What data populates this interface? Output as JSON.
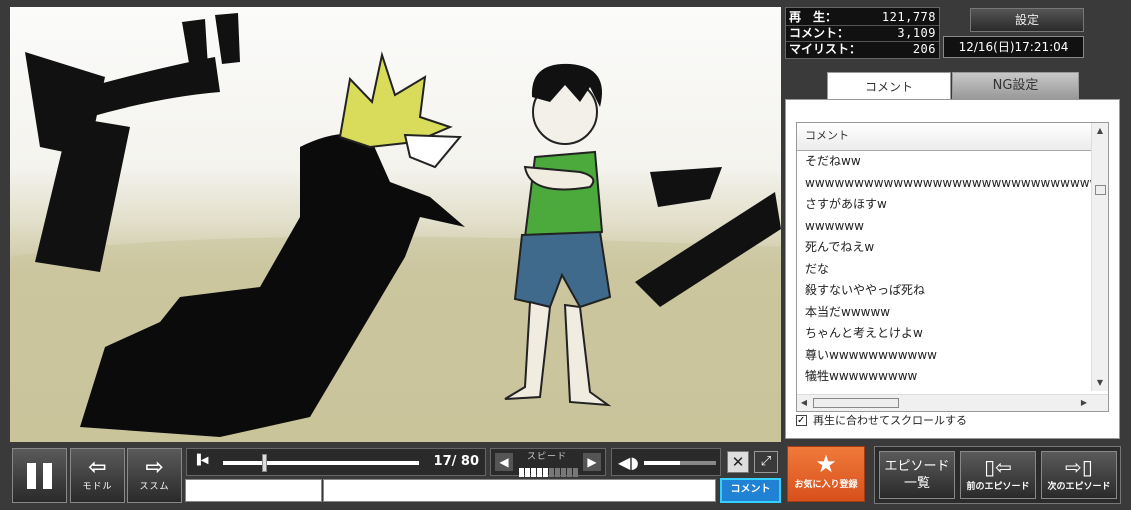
{
  "stats": {
    "views_label": "再　生：",
    "views_value": "121,778",
    "comments_label": "コメント：",
    "comments_value": "3,109",
    "mylist_label": "マイリスト：",
    "mylist_value": "206"
  },
  "settings_label": "設定",
  "clock": "12/16(日)17:21:04",
  "tabs": {
    "comment": "コメント",
    "ng": "NG設定"
  },
  "comment_list": {
    "header": "コメント",
    "rows": [
      "そだねww",
      "wwwwwwwwwwwwwwwwwwwwwwwwwwwwwww",
      "さすがあほすw",
      "wwwwww",
      "死んでねえw",
      "だな",
      "殺すないややっぱ死ね",
      "本当だwwwww",
      "ちゃんと考えとけよw",
      "尊いwwwwwwwwwww",
      "犠牲wwwwwwwww"
    ],
    "autoscroll_label": "再生に合わせてスクロールする"
  },
  "controls": {
    "back_caption": "モドル",
    "fwd_caption": "ススム",
    "time_text": "17/ 80",
    "seek_fraction": 0.21,
    "speed_label": "スピード",
    "speed_level": 5,
    "speed_max": 10,
    "volume_fraction": 0.5
  },
  "comment_input": {
    "command_value": "",
    "comment_value": "",
    "submit_label": "コメント"
  },
  "buttons": {
    "favorite": "お気に入り登録",
    "episode_list": "エピソード一覧",
    "prev_episode": "前のエピソード",
    "next_episode": "次のエピソード"
  },
  "colors": {
    "accent_orange": "#e0602a",
    "comment_button": "#1f82d4",
    "shirt_green": "#4caa3c",
    "hair_yellow": "#d8dc5a",
    "shorts_blue": "#3f6a8c"
  },
  "icons": [
    "pause-icon",
    "left-arrow-icon",
    "right-arrow-icon",
    "skip-start-icon",
    "speaker-icon",
    "close-icon",
    "fullscreen-icon",
    "star-icon"
  ]
}
